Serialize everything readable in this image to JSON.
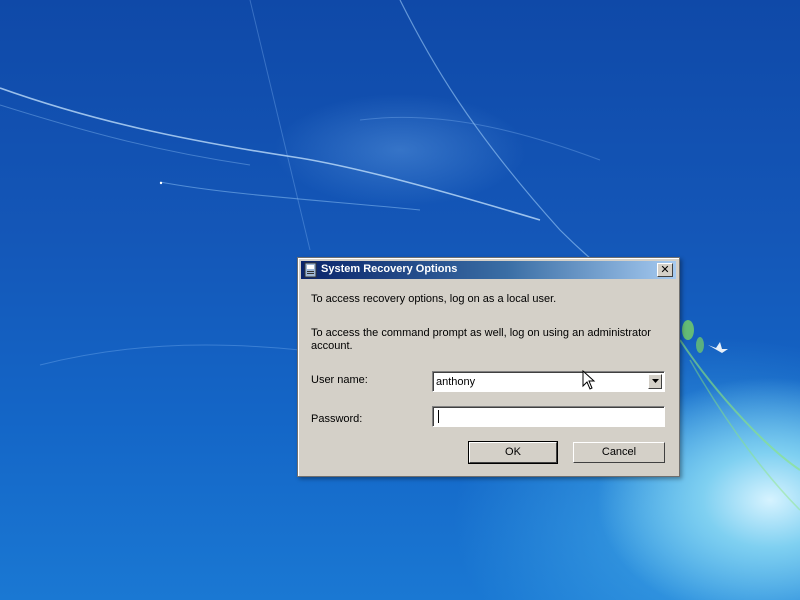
{
  "dialog": {
    "title": "System Recovery Options",
    "intro": "To access recovery options, log on as a local user.",
    "admin_note_line1": "To access the command prompt as well, log on using an administrator",
    "admin_note_line2": "account.",
    "username_label": "User name:",
    "username_value": "anthony",
    "password_label": "Password:",
    "password_value": "",
    "ok_label": "OK",
    "cancel_label": "Cancel",
    "close_glyph": "✕"
  },
  "icons": {
    "title_icon": "system-recovery-icon",
    "close": "close-icon",
    "dropdown": "chevron-down-icon",
    "pointer": "mouse-pointer-icon"
  },
  "colors": {
    "desktop": "#1457b8",
    "dialog_face": "#d4d0c8",
    "titlebar_start": "#0a246a",
    "titlebar_end": "#a6caf0"
  }
}
